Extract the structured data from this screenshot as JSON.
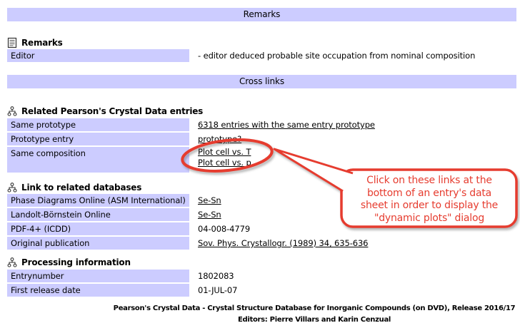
{
  "bars": {
    "remarks": "Remarks",
    "cross_links": "Cross links"
  },
  "sections": [
    {
      "title": "Remarks",
      "rows": [
        {
          "label": "Editor",
          "value": "- editor deduced probable site occupation from nominal composition"
        }
      ]
    },
    {
      "title": "Related Pearson's Crystal Data entries",
      "rows": [
        {
          "label": "Same prototype",
          "value": "6318 entries with the same entry prototype"
        },
        {
          "label": "Prototype entry",
          "value": "prototype?"
        },
        {
          "label": "Same composition",
          "links": [
            "Plot cell vs. T",
            "Plot cell vs. p"
          ]
        }
      ]
    },
    {
      "title": "Link to related databases",
      "rows": [
        {
          "label": "Phase Diagrams Online (ASM International)",
          "value": "Se-Sn"
        },
        {
          "label": "Landolt-Börnstein Online",
          "value": "Se-Sn"
        },
        {
          "label": "PDF-4+ (ICDD)",
          "value": "04-008-4779"
        },
        {
          "label": "Original publication",
          "value": "Sov. Phys. Crystallogr. (1989) 34, 635-636"
        }
      ]
    },
    {
      "title": "Processing information",
      "rows": [
        {
          "label": "Entrynumber",
          "value": "1802083"
        },
        {
          "label": "First release date",
          "value": "01-JUL-07"
        }
      ]
    }
  ],
  "annotation": {
    "text": "Click on these links at the\nbottom of an entry's data\nsheet in order to display the\n\"dynamic plots\" dialog"
  },
  "footer": {
    "line1": "Pearson's Crystal Data - Crystal Structure Database for Inorganic Compounds (on DVD), Release 2016/17",
    "line2": "Editors: Pierre Villars and Karin Cenzual"
  },
  "colors": {
    "band": "#ccccff",
    "accent-red": "#e63c2f",
    "ink": "#000000"
  }
}
